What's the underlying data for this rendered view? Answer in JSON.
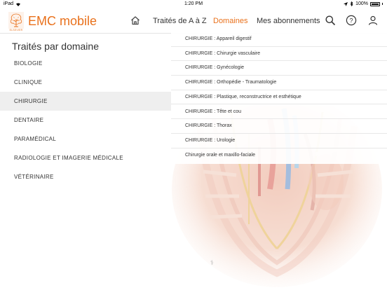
{
  "status_bar": {
    "device": "iPad",
    "time": "1:20 PM",
    "battery": "100%"
  },
  "header": {
    "app_title": "EMC mobile",
    "logo_caption": "ELSEVIER",
    "nav": [
      {
        "label": "Traités de A à Z"
      },
      {
        "label": "Domaines"
      },
      {
        "label": "Mes abonnements"
      }
    ],
    "accent_color": "#e9711c"
  },
  "left_panel": {
    "title": "Traités par domaine",
    "items": [
      {
        "label": "BIOLOGIE"
      },
      {
        "label": "CLINIQUE"
      },
      {
        "label": "CHIRURGIE"
      },
      {
        "label": "DENTAIRE"
      },
      {
        "label": "PARAMÉDICAL"
      },
      {
        "label": "RADIOLOGIE ET IMAGERIE MÉDICALE"
      },
      {
        "label": "VÉTÉRINAIRE"
      }
    ],
    "selected": "CHIRURGIE"
  },
  "sub_menu": {
    "items": [
      {
        "label": "CHIRURGIE : Appareil digestif"
      },
      {
        "label": "CHIRURGIE : Chirurgie vasculaire"
      },
      {
        "label": "CHIRURGIE : Gynécologie"
      },
      {
        "label": "CHIRURGIE : Orthopédie - Traumatologie"
      },
      {
        "label": "CHIRURGIE : Plastique, reconstructrice et esthétique"
      },
      {
        "label": "CHIRURGIE : Tête et cou"
      },
      {
        "label": "CHIRURGIE : Thorax"
      },
      {
        "label": "CHIRURGIE : Urologie"
      },
      {
        "label": "Chirurgie orale et maxillo-faciale"
      }
    ]
  }
}
